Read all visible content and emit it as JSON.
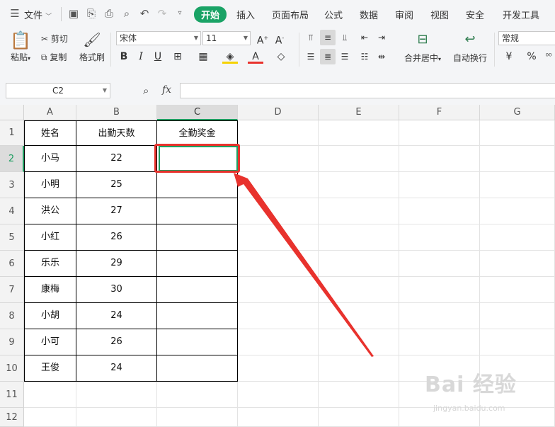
{
  "menu": {
    "file_label": "文件",
    "tabs": [
      "开始",
      "插入",
      "页面布局",
      "公式",
      "数据",
      "审阅",
      "视图",
      "安全",
      "开发工具"
    ],
    "active_tab": "开始"
  },
  "ribbon": {
    "paste": "粘贴",
    "cut": "剪切",
    "copy": "复制",
    "format_painter": "格式刷",
    "font_name": "宋体",
    "font_size": "11",
    "merge_center": "合并居中",
    "wrap_text": "自动换行",
    "number_format": "常规"
  },
  "formula_bar": {
    "name_box": "C2",
    "fx": "fx",
    "formula": ""
  },
  "sheet": {
    "columns": [
      "A",
      "B",
      "C",
      "D",
      "E",
      "F",
      "G"
    ],
    "rows": [
      "1",
      "2",
      "3",
      "4",
      "5",
      "6",
      "7",
      "8",
      "9",
      "10",
      "11",
      "12"
    ],
    "header": [
      "姓名",
      "出勤天数",
      "全勤奖金"
    ],
    "data": [
      [
        "小马",
        "22",
        ""
      ],
      [
        "小明",
        "25",
        ""
      ],
      [
        "洪公",
        "27",
        ""
      ],
      [
        "小红",
        "26",
        ""
      ],
      [
        "乐乐",
        "29",
        ""
      ],
      [
        "康梅",
        "30",
        ""
      ],
      [
        "小胡",
        "24",
        ""
      ],
      [
        "小可",
        "26",
        ""
      ],
      [
        "王俊",
        "24",
        ""
      ]
    ],
    "active_cell": "C2"
  },
  "watermark": {
    "main": "Bai 经验",
    "sub": "jingyan.baidu.com"
  },
  "colors": {
    "accent": "#1aa366",
    "annotation": "#e8322d"
  }
}
